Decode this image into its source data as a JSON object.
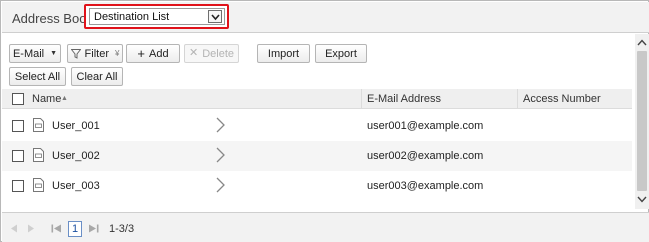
{
  "header": {
    "title": "Address Books",
    "destination_select": {
      "value": "Destination List"
    }
  },
  "toolbar": {
    "type_filter": "E-Mail",
    "filter_label": "Filter",
    "add_label": "Add",
    "delete_label": "Delete",
    "import_label": "Import",
    "export_label": "Export",
    "select_all_label": "Select All",
    "clear_all_label": "Clear All"
  },
  "table": {
    "columns": [
      "Name",
      "E-Mail Address",
      "Access Number"
    ],
    "sort": {
      "column": "Name",
      "direction": "ascending"
    },
    "rows": [
      {
        "name": "User_001",
        "email": "user001@example.com",
        "access_number": ""
      },
      {
        "name": "User_002",
        "email": "user002@example.com",
        "access_number": ""
      },
      {
        "name": "User_003",
        "email": "user003@example.com",
        "access_number": ""
      }
    ]
  },
  "pagination": {
    "current_page": "1",
    "range": "1-3/3"
  },
  "colors": {
    "highlight_border": "#e0121a",
    "header_bg": "#f2f2f2",
    "alt_row_bg": "#f5f5f5"
  }
}
